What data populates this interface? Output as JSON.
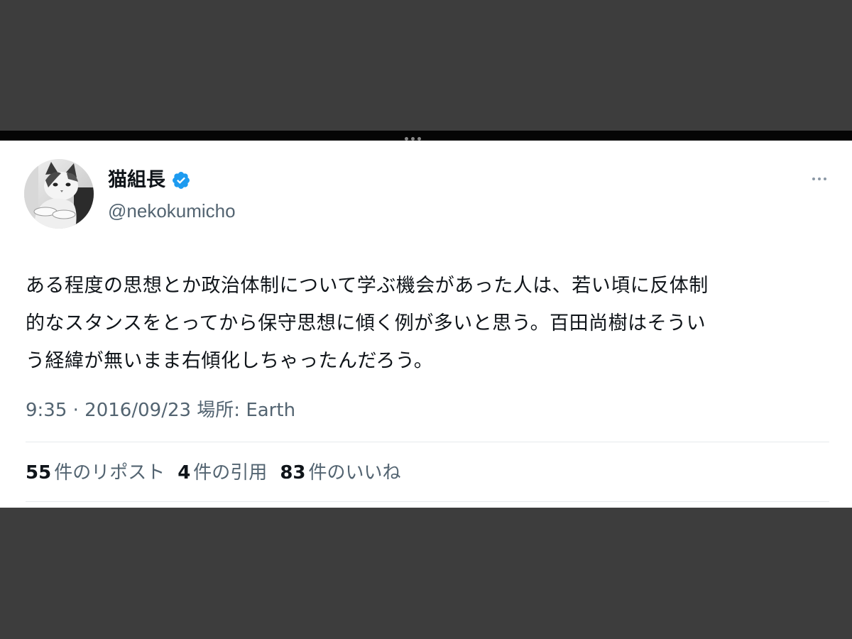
{
  "tweet": {
    "display_name": "猫組長",
    "handle": "@nekokumicho",
    "verified": true,
    "text_lines": [
      "ある程度の思想とか政治体制について学ぶ機会があった人は、若い頃に反体制",
      "的なスタンスをとってから保守思想に傾く例が多いと思う。百田尚樹はそうい",
      "う経緯が無いまま右傾化しちゃったんだろう。"
    ],
    "meta": "9:35 · 2016/09/23 場所: Earth",
    "stats": [
      {
        "count": "55",
        "label": "件のリポスト"
      },
      {
        "count": "4",
        "label": "件の引用"
      },
      {
        "count": "83",
        "label": "件のいいね"
      }
    ]
  },
  "icons": {
    "verified": "verified-badge-icon",
    "more": "more-options-icon",
    "avatar": "cat-avatar"
  },
  "colors": {
    "verified_blue": "#1d9bf0",
    "text": "#0f1419",
    "secondary_text": "#536471",
    "background_dark": "#3d3d3d"
  }
}
